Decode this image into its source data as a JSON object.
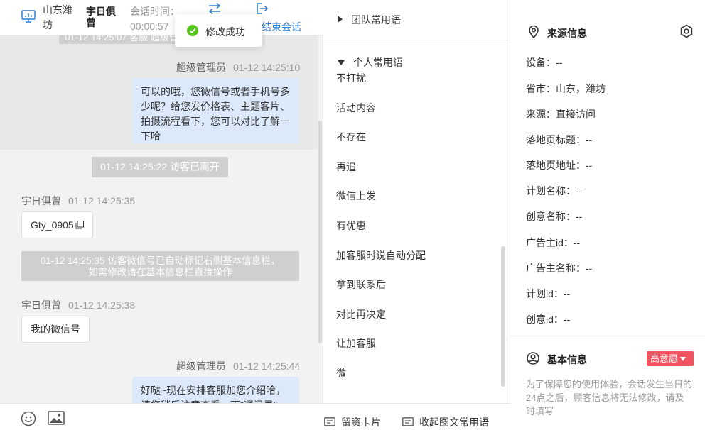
{
  "header": {
    "location": "山东潍坊",
    "visitor_name": "宇日俱曾",
    "session_time_label": "会话时间：",
    "session_time": "00:00:57",
    "end_session": "结束会话"
  },
  "toast": {
    "text": "修改成功"
  },
  "messages": [
    {
      "type": "system",
      "text": "01-12 14:25:07 客服 超级管理员"
    },
    {
      "type": "agent_meta",
      "sender": "超级管理员",
      "time": "01-12 14:25:10"
    },
    {
      "type": "agent_text",
      "text": "可以的哦，您微信号或者手机号多少呢？给您发价格表、主题客片、拍摄流程看下，您可以对比了解一下哈"
    },
    {
      "type": "system",
      "text": "01-12 14:25:22 访客已离开"
    },
    {
      "type": "visitor_meta",
      "sender": "宇日俱曾",
      "time": "01-12 14:25:35"
    },
    {
      "type": "visitor_text",
      "text": "Gty_0905"
    },
    {
      "type": "system",
      "text": "01-12 14:25:35 访客微信号已自动标记右侧基本信息栏，如需修改请在基本信息栏直接操作"
    },
    {
      "type": "visitor_meta",
      "sender": "宇日俱曾",
      "time": "01-12 14:25:38"
    },
    {
      "type": "visitor_text",
      "text": "我的微信号"
    },
    {
      "type": "agent_meta",
      "sender": "超级管理员",
      "time": "01-12 14:25:44"
    },
    {
      "type": "agent_text",
      "text": "好哒~现在安排客服加您介绍哈，请您稍后注意查看一下\"通讯录\""
    }
  ],
  "footer": {
    "contact_card": "留资卡片",
    "collapse_phrases": "收起图文常用语"
  },
  "phrases": {
    "team_group": "团队常用语",
    "personal_group": "个人常用语",
    "items": [
      "不打扰",
      "活动内容",
      "不存在",
      "再追",
      "微信上发",
      "有优惠",
      "加客服时说自动分配",
      "拿到联系后",
      "对比再决定",
      "让加客服",
      "微"
    ]
  },
  "source_info": {
    "title": "来源信息",
    "rows": [
      "设备：--",
      "省市：山东，潍坊",
      "来源：直接访问",
      "落地页标题：--",
      "落地页地址：--",
      "计划名称：--",
      "创意名称：--",
      "广告主id：--",
      "广告主名称：--",
      "计划id：--",
      "创意id：--"
    ]
  },
  "basic_info": {
    "title": "基本信息",
    "intent_badge": "高意愿",
    "note": "为了保障您的使用体验，会话发生当日的24点之后，顾客信息将无法修改，请及时填写"
  },
  "colors": {
    "accent": "#2f7fd8",
    "agent_bubble": "#dce9fb",
    "system_bg": "#cfcfcf",
    "success": "#52c41a",
    "intent_badge": "#f0555f"
  }
}
